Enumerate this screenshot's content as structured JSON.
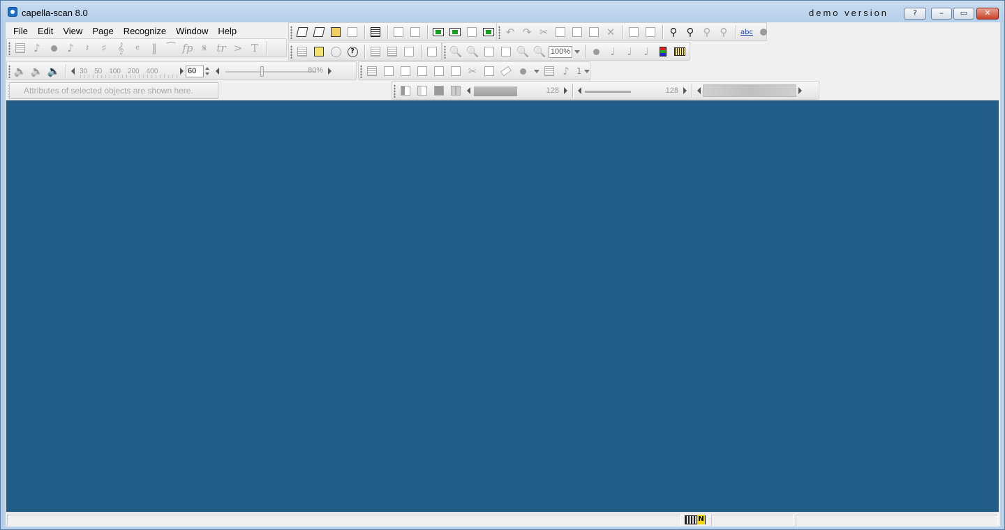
{
  "window": {
    "title": "capella-scan 8.0",
    "demo_label": "demo version",
    "help_glyph": "?",
    "minimize_glyph": "–",
    "maximize_glyph": "▭",
    "close_glyph": "✕"
  },
  "menu": {
    "file": "File",
    "edit": "Edit",
    "view": "View",
    "page": "Page",
    "recognize": "Recognize",
    "window": "Window",
    "help": "Help"
  },
  "playback": {
    "tempo_ticks": [
      "30",
      "50",
      "100",
      "200",
      "400"
    ],
    "tempo_value": "60",
    "volume_value": "80%",
    "volume_level": 0.8
  },
  "view": {
    "zoom": "100%"
  },
  "layout": {
    "staff_value": "1"
  },
  "attributes": {
    "hint": "Attributes of selected objects are shown here."
  },
  "image_controls": {
    "brightness_value": "128",
    "brightness_level": 0.5,
    "contrast_value": "128",
    "contrast_level": 0.5
  },
  "icons": {
    "note_glyph": "♪",
    "quarter_glyph": "♩",
    "eighth_glyph": "♪",
    "rest_glyph": "𝄽",
    "sharp_glyph": "♯",
    "clef_glyph": "𝄞",
    "time_glyph": "𝄴",
    "barline_glyph": "‖",
    "slur_glyph": "⁀",
    "dynamic_glyph": "fp",
    "segno_glyph": "𝄋",
    "trill_glyph": "tr",
    "accent_glyph": ">",
    "text_glyph": "T",
    "search_glyph": "🔍",
    "undo_glyph": "↶",
    "redo_glyph": "↷",
    "cut_glyph": "✂",
    "delete_glyph": "✕",
    "binoculars_glyph": "⚲",
    "spell_glyph": "abc",
    "speaker_glyph": "🔈"
  }
}
